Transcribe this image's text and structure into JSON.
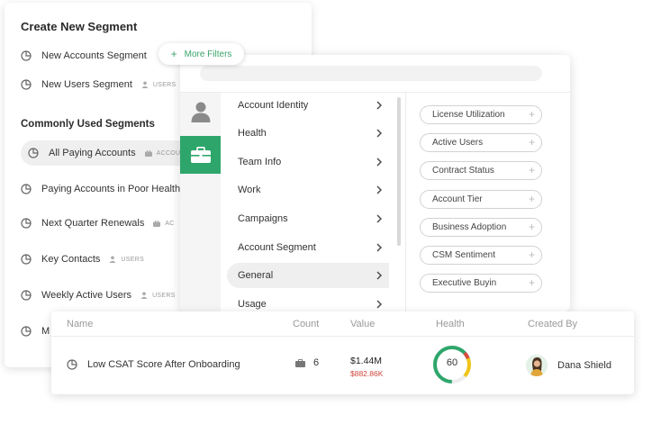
{
  "segments": {
    "create_title": "Create New Segment",
    "create_items": [
      {
        "label": "New Accounts Segment",
        "tag": ""
      },
      {
        "label": "New Users Segment",
        "tag": "USERS"
      }
    ],
    "common_title": "Commonly Used Segments",
    "common_items": [
      {
        "label": "All Paying Accounts",
        "tag": "ACCOUN"
      },
      {
        "label": "Paying Accounts in Poor Health",
        "tag": ""
      },
      {
        "label": "Next Quarter Renewals",
        "tag": "AC"
      },
      {
        "label": "Key Contacts",
        "tag": "USERS"
      },
      {
        "label": "Weekly Active Users",
        "tag": "USERS"
      },
      {
        "label": "M",
        "tag": ""
      }
    ]
  },
  "more_filters": {
    "icon": "plus-icon",
    "label": "More Filters"
  },
  "filter_panel": {
    "rail_icons": [
      "person-icon",
      "briefcase-icon"
    ],
    "categories": [
      "Account Identity",
      "Health",
      "Team Info",
      "Work",
      "Campaigns",
      "Account Segment",
      "General",
      "Usage"
    ],
    "active_category": "General",
    "fields": [
      "License Utilization",
      "Active Users",
      "Contract Status",
      "Account Tier",
      "Business Adoption",
      "CSM Sentiment",
      "Executive Buyin"
    ]
  },
  "table": {
    "headers": {
      "name": "Name",
      "count": "Count",
      "value": "Value",
      "health": "Health",
      "created_by": "Created By"
    },
    "row": {
      "name": "Low CSAT Score After Onboarding",
      "count": "6",
      "value": "$1.44M",
      "value_sub": "$882.86K",
      "health": "60",
      "created_by": "Dana Shield"
    }
  },
  "colors": {
    "accent": "#2ea66b",
    "negative": "#d0463b",
    "gauge_yellow": "#f0c419",
    "gauge_red": "#d94c3d"
  }
}
